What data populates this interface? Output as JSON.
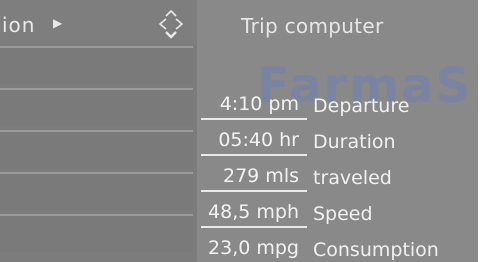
{
  "menu": {
    "title": "ion",
    "arrow_icon": "triangle-right-icon",
    "nav_icon": "four-way-controller-icon",
    "rows": [
      "",
      "",
      "",
      "",
      ""
    ]
  },
  "trip": {
    "title": "Trip computer",
    "watermark": "FarmaS",
    "items": [
      {
        "value": "4:10 pm",
        "label": "Departure"
      },
      {
        "value": "05:40 hr",
        "label": "Duration"
      },
      {
        "value": "279 mls",
        "label": "traveled"
      },
      {
        "value": "48,5 mph",
        "label": "Speed"
      },
      {
        "value": "23,0 mpg",
        "label": "Consumption"
      }
    ]
  },
  "colors": {
    "menu_bg": "#7c7c7c",
    "panel_bg": "#898989",
    "text": "#f0f0f0",
    "watermark": "#5f78d2"
  }
}
